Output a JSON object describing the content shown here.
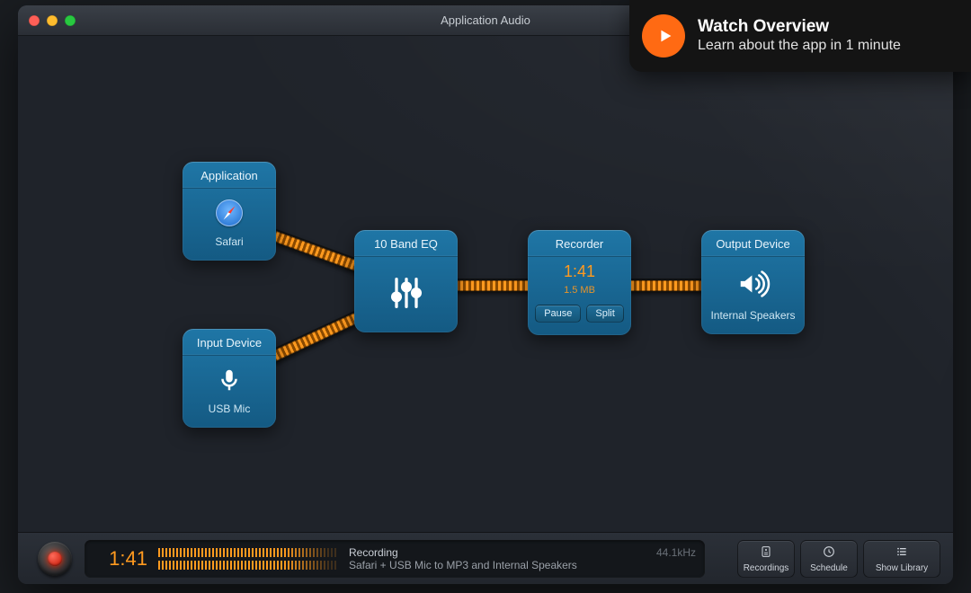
{
  "window": {
    "title": "Application Audio"
  },
  "overlay": {
    "title": "Watch Overview",
    "subtitle": "Learn about the app in 1 minute"
  },
  "nodes": {
    "application": {
      "header": "Application",
      "label": "Safari"
    },
    "input_device": {
      "header": "Input Device",
      "label": "USB Mic"
    },
    "eq": {
      "header": "10 Band EQ"
    },
    "recorder": {
      "header": "Recorder",
      "time": "1:41",
      "size": "1.5 MB",
      "pause_label": "Pause",
      "split_label": "Split"
    },
    "output_device": {
      "header": "Output Device",
      "label": "Internal Speakers"
    }
  },
  "status": {
    "time": "1:41",
    "state": "Recording",
    "sample_rate": "44.1kHz",
    "description": "Safari + USB Mic to MP3 and Internal Speakers"
  },
  "actions": {
    "recordings": "Recordings",
    "schedule": "Schedule",
    "show_library": "Show Library"
  },
  "colors": {
    "accent_orange": "#ff9a1f",
    "node_blue_top": "#1f76a6",
    "node_blue_bottom": "#145a83"
  }
}
